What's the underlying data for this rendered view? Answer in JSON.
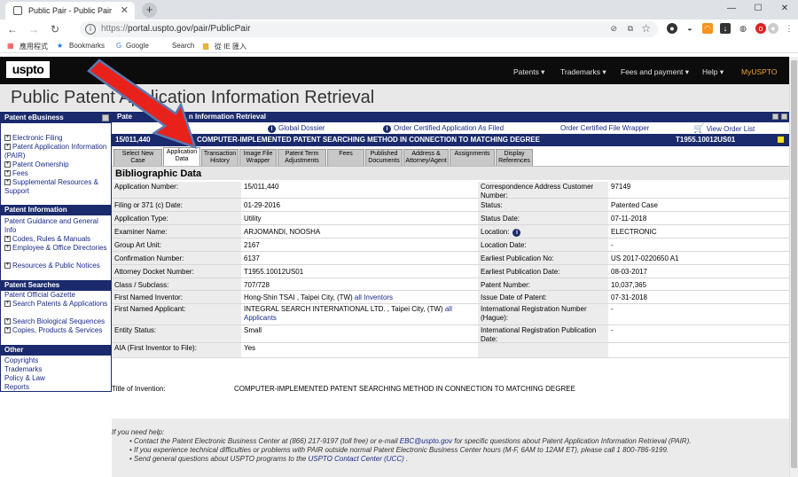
{
  "browser": {
    "tab_title": "Public Pair - Public Pair",
    "url_scheme": "https://",
    "url_rest": "portal.uspto.gov/pair/PublicPair",
    "bookmarks": [
      "應用程式",
      "Bookmarks",
      "Google",
      "Search",
      "從 IE 匯入"
    ]
  },
  "header": {
    "logo": "uspto",
    "nav": [
      "Patents ▾",
      "Trademarks ▾",
      "Fees and payment ▾",
      "Help ▾",
      "MyUSPTO"
    ],
    "banner": "Public Patent Application Information Retrieval"
  },
  "sidebar": {
    "sections": [
      {
        "title": "Patent eBusiness",
        "items": [
          "Electronic Filing",
          "Patent Application Information (PAIR)",
          "Patent Ownership",
          "Fees",
          "Supplemental Resources & Support"
        ]
      },
      {
        "title": "Patent Information",
        "items": [
          "Patent Guidance and General Info",
          "Codes, Rules & Manuals",
          "Employee & Office Directories",
          "Resources & Public Notices"
        ]
      },
      {
        "title": "Patent Searches",
        "items": [
          "Patent Official Gazette",
          "Search Patents & Applications",
          "Search Biological Sequences",
          "Copies, Products & Services"
        ]
      },
      {
        "title": "Other",
        "items": [
          "Copyrights",
          "Trademarks",
          "Policy & Law",
          "Reports"
        ]
      }
    ]
  },
  "main": {
    "header_left": "Patent Application Information Retrieval",
    "header_hidden_prefix": "Pate",
    "header_visible": "n Information Retrieval",
    "links": [
      "Global Dossier",
      "Order Certified Application As Filed",
      "Order Certified File Wrapper",
      "View Order List"
    ],
    "app_number": "15/011,440",
    "app_title": "COMPUTER-IMPLEMENTED PATENT SEARCHING METHOD IN CONNECTION TO MATCHING DEGREE",
    "docket": "T1955.10012US01",
    "tabs": [
      "Select New Case",
      "Application Data",
      "Transaction History",
      "Image File Wrapper",
      "Patent Term Adjustments",
      "Fees",
      "Published Documents",
      "Address & Attorney/Agent",
      "Assignments",
      "Display References"
    ],
    "section_title": "Bibliographic Data",
    "left_rows": [
      {
        "label": "Application Number:",
        "value": "15/011,440"
      },
      {
        "label": "Filing or 371 (c) Date:",
        "value": "01-29-2016"
      },
      {
        "label": "Application Type:",
        "value": "Utility"
      },
      {
        "label": "Examiner Name:",
        "value": "ARJOMANDI, NOOSHA"
      },
      {
        "label": "Group Art Unit:",
        "value": "2167"
      },
      {
        "label": "Confirmation Number:",
        "value": "6137"
      },
      {
        "label": "Attorney Docket Number:",
        "value": "T1955.10012US01"
      },
      {
        "label": "Class / Subclass:",
        "value": "707/728"
      },
      {
        "label": "First Named Inventor:",
        "value": "Hong-Shin TSAI , Taipei City, (TW)",
        "link": "all Inventors"
      },
      {
        "label": "First Named Applicant:",
        "value": "INTEGRAL SEARCH INTERNATIONAL LTD. , Taipei City, (TW)",
        "link": "all Applicants"
      },
      {
        "label": "Entity Status:",
        "value": "Small"
      },
      {
        "label": "AIA (First Inventor to File):",
        "value": "Yes"
      }
    ],
    "right_rows": [
      {
        "label": "Correspondence Address Customer Number:",
        "value": "97149"
      },
      {
        "label": "Status:",
        "value": "Patented Case"
      },
      {
        "label": "Status Date:",
        "value": "07-11-2018"
      },
      {
        "label": "Location:",
        "value": "ELECTRONIC"
      },
      {
        "label": "Location Date:",
        "value": "-"
      },
      {
        "label": "Earliest Publication No:",
        "value": "US 2017-0220650 A1"
      },
      {
        "label": "Earliest Publication Date:",
        "value": "08-03-2017"
      },
      {
        "label": "Patent Number:",
        "value": "10,037,365"
      },
      {
        "label": "Issue Date of Patent:",
        "value": "07-31-2018"
      },
      {
        "label": "International Registration Number (Hague):",
        "value": "-"
      },
      {
        "label": "International Registration Publication Date:",
        "value": "-"
      },
      {
        "label": "",
        "value": ""
      }
    ],
    "title_label": "Title of Invention:",
    "title_value": "COMPUTER-IMPLEMENTED PATENT SEARCHING METHOD IN CONNECTION TO MATCHING DEGREE"
  },
  "help": {
    "intro": "If you need help:",
    "line1_pre": "Contact the Patent Electronic Business Center at (866) 217-9197 (toll free) or e-mail ",
    "line1_link": "EBC@uspto.gov",
    "line1_post": " for specific questions about Patent Application Information Retrieval (PAIR).",
    "line2": "If you experience technical difficulties or problems with PAIR outside normal Patent Electronic Business Center hours (M-F, 6AM to 12AM ET), please call 1 800-786-9199.",
    "line3_pre": "Send general questions about USPTO programs to the ",
    "line3_link": "USPTO Contact Center (UCC)",
    "line3_post": " ."
  },
  "colors": {
    "nav_blue": "#1a2a6c",
    "arrow_red": "#e8221b",
    "myuspto": "#f0a030"
  }
}
